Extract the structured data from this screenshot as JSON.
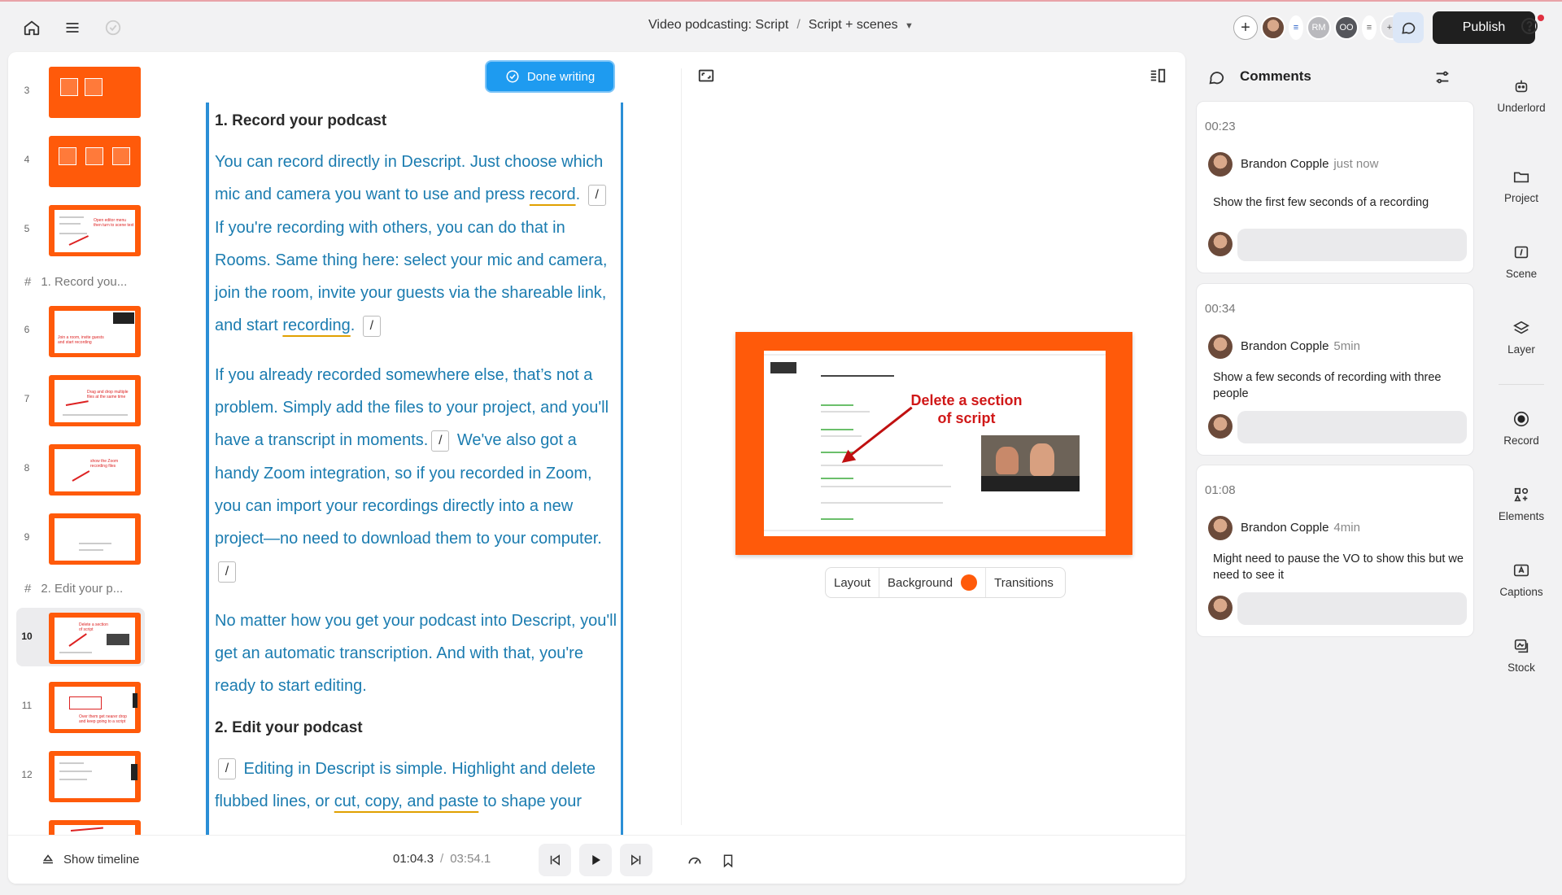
{
  "header": {
    "breadcrumb_project": "Video podcasting: Script",
    "breadcrumb_sep": "/",
    "breadcrumb_view": "Script + scenes",
    "collaborators": [
      "RM",
      "OO",
      "+1"
    ],
    "publish_label": "Publish"
  },
  "scenes": {
    "rows": [
      {
        "num": "3"
      },
      {
        "num": "4"
      },
      {
        "num": "5"
      },
      {
        "num": "6"
      },
      {
        "num": "7"
      },
      {
        "num": "8"
      },
      {
        "num": "9"
      },
      {
        "num": "10"
      },
      {
        "num": "11"
      },
      {
        "num": "12"
      }
    ],
    "sections": [
      "1. Record you...",
      "2. Edit your p..."
    ],
    "hash": "#"
  },
  "editor": {
    "done_label": "Done writing",
    "h1": "1. Record your podcast",
    "p1a": "You can record directly in Descript. Just choose which mic and camera you want to use and press ",
    "p1link": "record",
    "p1b": " If you're recording with others, you can do that in Rooms. Same thing here: select your mic and camera, join the room, invite your guests via the shareable link, and start ",
    "p1link2": "recording",
    "p2a": "If you already recorded somewhere else, that’s not a problem. Simply add the files to your project, and you'll have a transcript in moments.",
    "p2b": " We've also got a handy Zoom integration, so if you recorded in Zoom, you can import your recordings directly into a new project—no need to download them to your computer.",
    "p3": "No matter how you get your podcast into Descript, you'll get an automatic transcription. And with that, you're ready to start editing.",
    "h2": "2. Edit your podcast",
    "p4a": " Editing in Descript is simple. Highlight and delete flubbed lines, or ",
    "p4link": "cut, copy, and paste",
    "p4b": " to shape your",
    "slash": "/"
  },
  "preview": {
    "annotation": "Delete a section of script",
    "layout_label": "Layout",
    "background_label": "Background",
    "transitions_label": "Transitions",
    "background_color": "#ff5a0a"
  },
  "transport": {
    "show_timeline": "Show timeline",
    "current_time": "01:04.3",
    "sep": "/",
    "total_time": "03:54.1"
  },
  "comments": {
    "title": "Comments",
    "items": [
      {
        "time": "00:23",
        "author": "Brandon Copple",
        "when": "just now",
        "text": "Show the first few seconds of a recording"
      },
      {
        "time": "00:34",
        "author": "Brandon Copple",
        "when": "5min",
        "text": "Show a few seconds of recording with three people"
      },
      {
        "time": "01:08",
        "author": "Brandon Copple",
        "when": "4min",
        "text": "Might need to pause the VO to show this but we need to see it"
      }
    ]
  },
  "rail": {
    "underlord": "Underlord",
    "project": "Project",
    "scene": "Scene",
    "layer": "Layer",
    "record": "Record",
    "elements": "Elements",
    "captions": "Captions",
    "stock": "Stock"
  },
  "colors": {
    "accent_blue": "#1e9bf0",
    "scene_orange": "#ff5a0a",
    "script_text": "#1b7cb0"
  }
}
